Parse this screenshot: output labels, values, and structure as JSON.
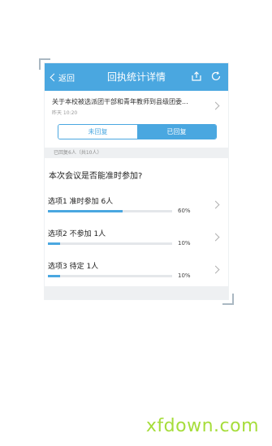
{
  "header": {
    "back_label": "返回",
    "title": "回执统计详情",
    "icons": [
      "share-icon",
      "refresh-icon"
    ]
  },
  "notice": {
    "title": "关于本校被选派团干部和青年教师到县级团委...",
    "time": "昨天 10:20"
  },
  "tabs": [
    {
      "label": "未回复",
      "active": false
    },
    {
      "label": "已回复",
      "active": true
    }
  ],
  "summary": "已回复6人（共10人）",
  "question": "本次会议是否能准时参加?",
  "options": [
    {
      "label": "选项1 准时参加  6人",
      "percent_text": "60%",
      "fraction": 0.6
    },
    {
      "label": "选项2 不参加  1人",
      "percent_text": "10%",
      "fraction": 0.1
    },
    {
      "label": "选项3 待定  1人",
      "percent_text": "10%",
      "fraction": 0.1
    }
  ],
  "watermark": "xfdown.com",
  "colors": {
    "accent": "#4aa7e0",
    "watermark": "#a6dd3b"
  }
}
